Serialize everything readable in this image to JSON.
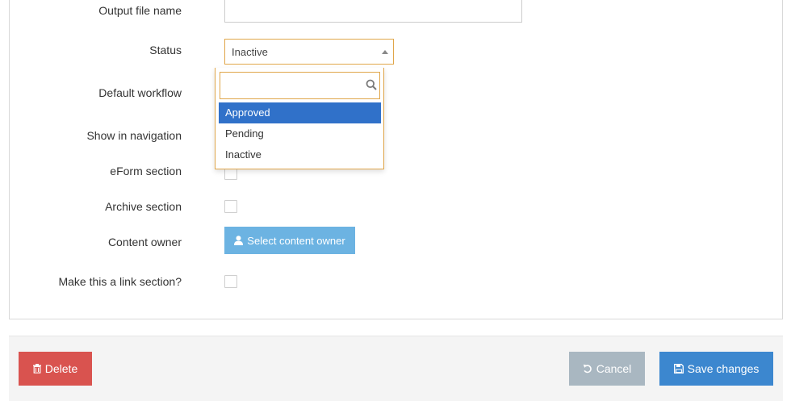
{
  "form": {
    "output_file_name": {
      "label": "Output file name",
      "value": ""
    },
    "status": {
      "label": "Status",
      "selected": "Inactive",
      "search_value": "",
      "options": [
        "Approved",
        "Pending",
        "Inactive"
      ],
      "highlighted": "Approved"
    },
    "default_workflow": {
      "label": "Default workflow"
    },
    "show_in_navigation": {
      "label": "Show in navigation"
    },
    "eform_section": {
      "label": "eForm section",
      "checked": false
    },
    "archive_section": {
      "label": "Archive section",
      "checked": false
    },
    "content_owner": {
      "label": "Content owner",
      "button_label": "Select content owner",
      "icon": "user-icon"
    },
    "link_section": {
      "label": "Make this a link section?",
      "checked": false
    }
  },
  "footer": {
    "delete_label": "Delete",
    "delete_icon": "trash-icon",
    "cancel_label": "Cancel",
    "cancel_icon": "undo-icon",
    "save_label": "Save changes",
    "save_icon": "floppy-disk-icon"
  },
  "colors": {
    "focus_border": "#e0a64a",
    "highlight": "#3071c9",
    "owner_button": "#6cb3e2",
    "delete_button": "#d9534f",
    "cancel_button": "#a9b7c1",
    "save_button": "#3c87cf"
  }
}
